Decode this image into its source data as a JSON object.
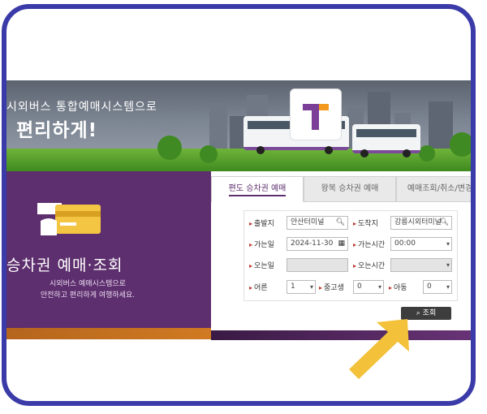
{
  "hero": {
    "title_line1": "시외버스 통합예매시스템으로",
    "title_line2": "편리하게!",
    "logo_letter": "T"
  },
  "left_panel": {
    "title": "승차권 예매·조회",
    "desc_line1": "시외버스 예매시스템으로",
    "desc_line2": "안전하고 편리하게 여행하세요."
  },
  "tabs": [
    {
      "label": "편도 승차권 예매",
      "active": true
    },
    {
      "label": "왕복 승차권 예매",
      "active": false
    },
    {
      "label": "예매조회/취소/변경",
      "active": false
    }
  ],
  "form": {
    "departure_label": "출발지",
    "departure_value": "안산터미널",
    "arrival_label": "도착지",
    "arrival_value": "강릉시외터미널",
    "go_date_label": "가는일",
    "go_date_value": "2024-11-30",
    "go_time_label": "가는시간",
    "go_time_value": "00:00",
    "return_date_label": "오는일",
    "return_time_label": "오는시간",
    "adult_label": "어른",
    "adult_value": "1",
    "student_label": "중고생",
    "student_value": "0",
    "child_label": "아동",
    "child_value": "0",
    "search_button": "조회"
  },
  "colors": {
    "frame": "#3a3aa8",
    "purple": "#5e2f6e",
    "arrow": "#f3c13a"
  },
  "icons": {
    "search": "search-icon",
    "calendar": "calendar-icon",
    "dropdown": "chevron-down-icon"
  }
}
